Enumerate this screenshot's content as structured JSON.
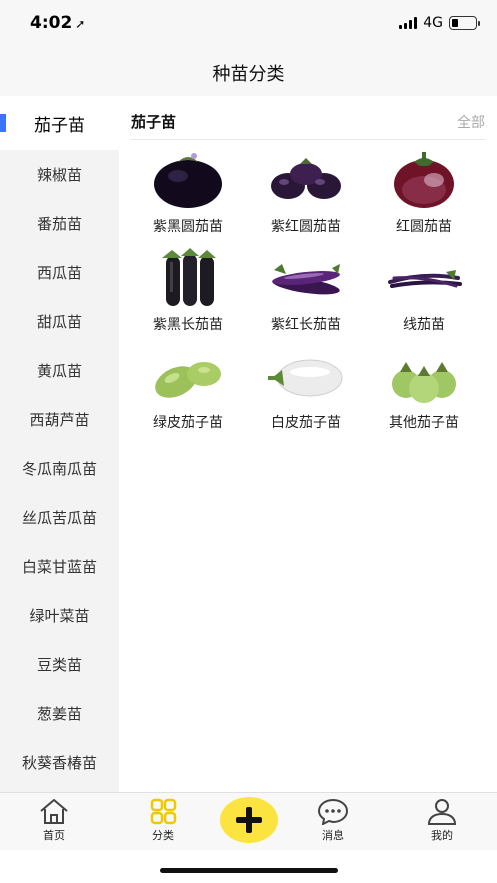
{
  "status_bar": {
    "time": "4:02",
    "network": "4G",
    "battery_percent": 25
  },
  "nav": {
    "title": "种苗分类"
  },
  "sidebar": {
    "items": [
      {
        "label": "茄子苗",
        "active": true
      },
      {
        "label": "辣椒苗"
      },
      {
        "label": "番茄苗"
      },
      {
        "label": "西瓜苗"
      },
      {
        "label": "甜瓜苗"
      },
      {
        "label": "黄瓜苗"
      },
      {
        "label": "西葫芦苗"
      },
      {
        "label": "冬瓜南瓜苗"
      },
      {
        "label": "丝瓜苦瓜苗"
      },
      {
        "label": "白菜甘蓝苗"
      },
      {
        "label": "绿叶菜苗"
      },
      {
        "label": "豆类苗"
      },
      {
        "label": "葱姜苗"
      },
      {
        "label": "秋葵香椿苗"
      }
    ]
  },
  "main": {
    "section_title": "茄子苗",
    "view_all_label": "全部",
    "products": [
      {
        "label": "紫黑圆茄苗",
        "icon": "round-black-eggplant-image"
      },
      {
        "label": "紫红圆茄苗",
        "icon": "round-purple-eggplant-image"
      },
      {
        "label": "红圆茄苗",
        "icon": "round-red-eggplant-image"
      },
      {
        "label": "紫黑长茄苗",
        "icon": "long-black-eggplant-image"
      },
      {
        "label": "紫红长茄苗",
        "icon": "long-purple-eggplant-image"
      },
      {
        "label": "线茄苗",
        "icon": "thin-eggplant-image"
      },
      {
        "label": "绿皮茄子苗",
        "icon": "green-eggplant-image"
      },
      {
        "label": "白皮茄子苗",
        "icon": "white-eggplant-image"
      },
      {
        "label": "其他茄子苗",
        "icon": "other-eggplant-image"
      }
    ]
  },
  "tab_bar": {
    "home_label": "首页",
    "category_label": "分类",
    "messages_label": "消息",
    "profile_label": "我的"
  },
  "colors": {
    "accent": "#3b73ff",
    "fab": "#fbe43f",
    "category_icon": "#f0c800"
  }
}
